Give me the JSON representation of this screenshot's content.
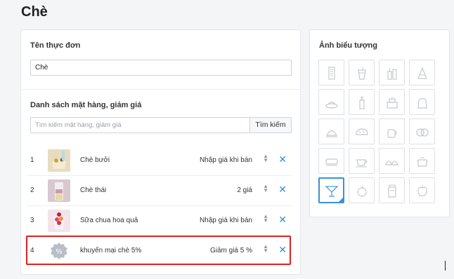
{
  "page": {
    "title": "Chè"
  },
  "menu": {
    "name_label": "Tên thực đơn",
    "name_value": "Chè"
  },
  "items_section": {
    "label": "Danh sách mặt hàng, giảm giá",
    "search_placeholder": "Tìm kiếm mặt hàng, giảm giá",
    "search_button": "Tìm kiếm",
    "rows": [
      {
        "index": "1",
        "name": "Chè bưởi",
        "price": "Nhập giá khi bán"
      },
      {
        "index": "2",
        "name": "Chè thái",
        "price": "2 giá"
      },
      {
        "index": "3",
        "name": "Sữa chua hoa quả",
        "price": "Nhập giá khi bán"
      },
      {
        "index": "4",
        "name": "khuyến mại chè 5%",
        "price": "Giảm giá 5 %"
      }
    ],
    "discount_badge": "%"
  },
  "icon_panel": {
    "label": "Ảnh biểu tượng",
    "icons": [
      "building-icon",
      "drink-cup-icon",
      "bottles-icon",
      "cake-slice-icon",
      "dish-icon",
      "wine-bottle-icon",
      "cake-icon",
      "dessert-jelly-icon",
      "cloche-icon",
      "bread-icon",
      "coffee-cup-icon",
      "donut-icon",
      "sushi-icon",
      "tea-cup-icon",
      "dumplings-icon",
      "pot-icon",
      "cocktail-icon",
      "fruit-icon",
      "jar-icon",
      "apple-icon"
    ],
    "selected_index": 16
  },
  "colors": {
    "accent": "#3a90d8",
    "highlight": "#e02020",
    "remove": "#2c8fe0"
  }
}
